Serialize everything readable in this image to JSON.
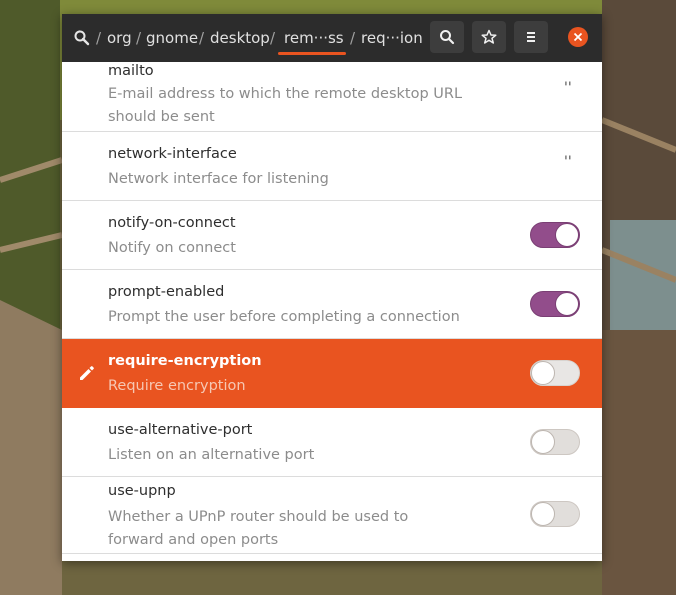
{
  "window": {
    "breadcrumbs": [
      "org",
      "gnome",
      "desktop",
      "rem···ss",
      "req···ion"
    ],
    "separator": "/"
  },
  "keys": [
    {
      "name": "mailto",
      "description": "E-mail address to which the remote desktop URL should be sent",
      "value": "''"
    },
    {
      "name": "network-interface",
      "description": "Network interface for listening",
      "value": "''"
    },
    {
      "name": "notify-on-connect",
      "description": "Notify on connect",
      "state": "on"
    },
    {
      "name": "prompt-enabled",
      "description": "Prompt the user before completing a connection",
      "state": "on"
    },
    {
      "name": "require-encryption",
      "description": "Require encryption",
      "state": "off",
      "selected": true
    },
    {
      "name": "use-alternative-port",
      "description": "Listen on an alternative port",
      "state": "off"
    },
    {
      "name": "use-upnp",
      "description": "Whether a UPnP router should be used to forward and open ports",
      "state": "off"
    }
  ],
  "colors": {
    "accent": "#e95420",
    "switch_on": "#924d8b",
    "headerbar": "#2c2c2c"
  }
}
